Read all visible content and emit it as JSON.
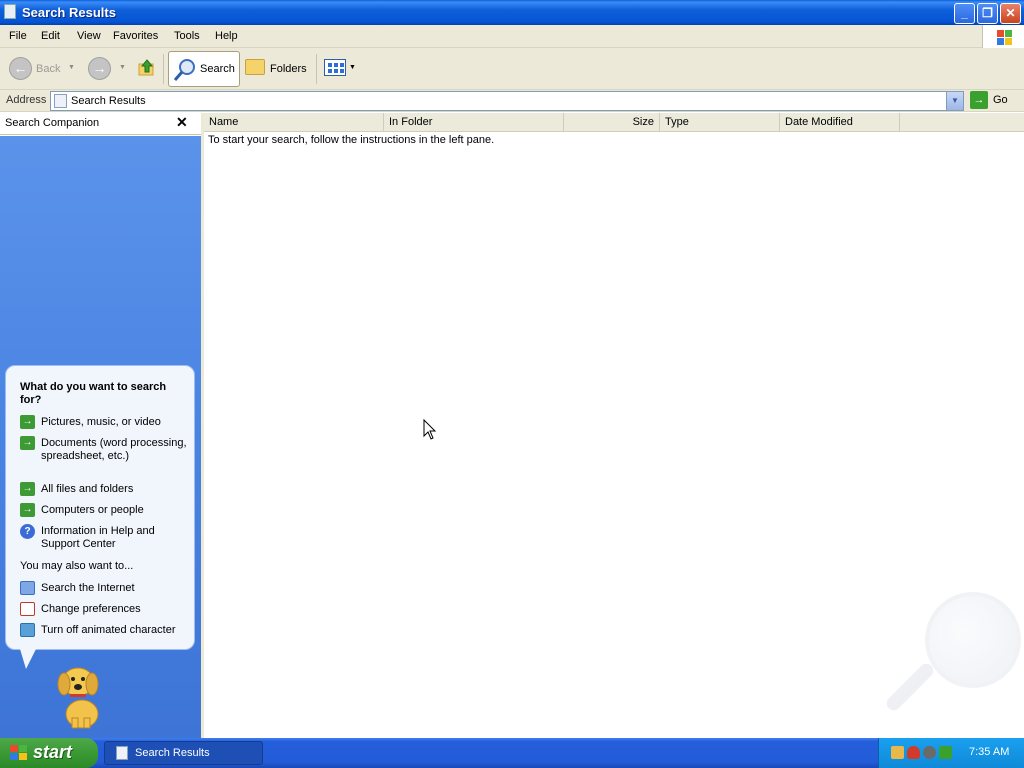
{
  "window": {
    "title": "Search Results"
  },
  "menu": [
    "File",
    "Edit",
    "View",
    "Favorites",
    "Tools",
    "Help"
  ],
  "toolbar": {
    "back_label": "Back",
    "search_label": "Search",
    "folders_label": "Folders"
  },
  "address": {
    "label": "Address",
    "value": "Search Results",
    "go_label": "Go"
  },
  "companion": {
    "header": "Search Companion",
    "heading": "What do you want to search for?",
    "options": [
      "Pictures, music, or video",
      "Documents (word processing, spreadsheet, etc.)",
      "All files and folders",
      "Computers or people",
      "Information in Help and Support Center"
    ],
    "also_label": "You may also want to...",
    "also_options": [
      "Search the Internet",
      "Change preferences",
      "Turn off animated character"
    ]
  },
  "results": {
    "columns": [
      "Name",
      "In Folder",
      "Size",
      "Type",
      "Date Modified"
    ],
    "instructions": "To start your search, follow the instructions in the left pane."
  },
  "taskbar": {
    "start_label": "start",
    "task_label": "Search Results",
    "clock": "7:35 AM"
  }
}
